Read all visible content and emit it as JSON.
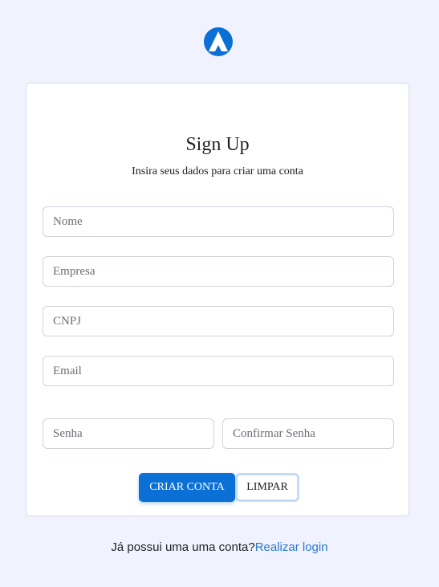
{
  "brand": {
    "logo_icon": "mountain-logo-icon",
    "color": "#0b70d6"
  },
  "card": {
    "title": "Sign Up",
    "subtitle": "Insira seus dados para criar uma conta"
  },
  "form": {
    "name_placeholder": "Nome",
    "company_placeholder": "Empresa",
    "cnpj_placeholder": "CNPJ",
    "email_placeholder": "Email",
    "password_placeholder": "Senha",
    "confirm_password_placeholder": "Confirmar Senha"
  },
  "actions": {
    "create_label": "CRIAR CONTA",
    "clear_label": "LIMPAR"
  },
  "footer": {
    "prompt": "Já possui uma uma conta?",
    "link": "Realizar login",
    "link_color": "#2a78d3"
  }
}
